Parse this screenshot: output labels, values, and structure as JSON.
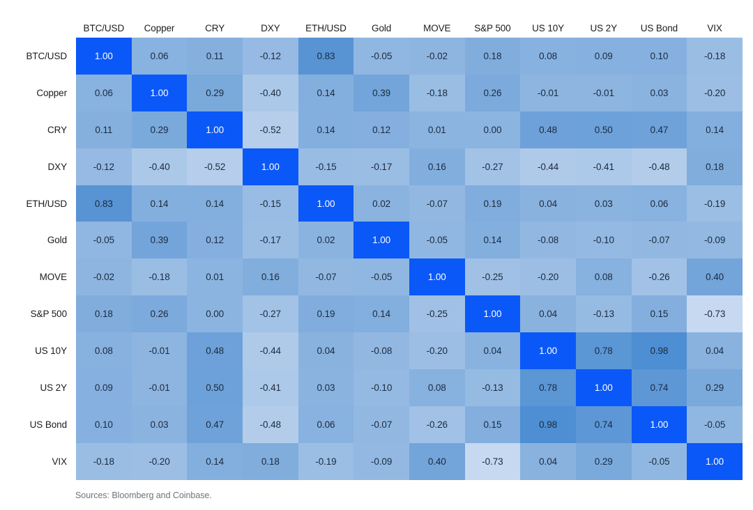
{
  "caption": "Sources: Bloomberg and Coinbase.",
  "colors": {
    "diagonal": "#0b58f8",
    "high_positive": "#4d8dd2",
    "neutral": "#8cb4e0",
    "low_negative": "#c8daf0",
    "text_dark": "#1b2a3e",
    "text_light": "#ffffff",
    "label_text": "#1c1c1e",
    "caption_text": "#6f7378",
    "background": "#ffffff"
  },
  "chart_data": {
    "type": "heatmap",
    "title": "",
    "xlabel": "",
    "ylabel": "",
    "grid": false,
    "legend": "none",
    "zlim": [
      -1,
      1
    ],
    "categories": [
      "BTC/USD",
      "Copper",
      "CRY",
      "DXY",
      "ETH/USD",
      "Gold",
      "MOVE",
      "S&P 500",
      "US 10Y",
      "US 2Y",
      "US Bond",
      "VIX"
    ],
    "x": [
      "BTC/USD",
      "Copper",
      "CRY",
      "DXY",
      "ETH/USD",
      "Gold",
      "MOVE",
      "S&P 500",
      "US 10Y",
      "US 2Y",
      "US Bond",
      "VIX"
    ],
    "y": [
      "BTC/USD",
      "Copper",
      "CRY",
      "DXY",
      "ETH/USD",
      "Gold",
      "MOVE",
      "S&P 500",
      "US 10Y",
      "US 2Y",
      "US Bond",
      "VIX"
    ],
    "values": [
      [
        1.0,
        0.06,
        0.11,
        -0.12,
        0.83,
        -0.05,
        -0.02,
        0.18,
        0.08,
        0.09,
        0.1,
        -0.18
      ],
      [
        0.06,
        1.0,
        0.29,
        -0.4,
        0.14,
        0.39,
        -0.18,
        0.26,
        -0.01,
        -0.01,
        0.03,
        -0.2
      ],
      [
        0.11,
        0.29,
        1.0,
        -0.52,
        0.14,
        0.12,
        0.01,
        0.0,
        0.48,
        0.5,
        0.47,
        0.14
      ],
      [
        -0.12,
        -0.4,
        -0.52,
        1.0,
        -0.15,
        -0.17,
        0.16,
        -0.27,
        -0.44,
        -0.41,
        -0.48,
        0.18
      ],
      [
        0.83,
        0.14,
        0.14,
        -0.15,
        1.0,
        0.02,
        -0.07,
        0.19,
        0.04,
        0.03,
        0.06,
        -0.19
      ],
      [
        -0.05,
        0.39,
        0.12,
        -0.17,
        0.02,
        1.0,
        -0.05,
        0.14,
        -0.08,
        -0.1,
        -0.07,
        -0.09
      ],
      [
        -0.02,
        -0.18,
        0.01,
        0.16,
        -0.07,
        -0.05,
        1.0,
        -0.25,
        -0.2,
        0.08,
        -0.26,
        0.4
      ],
      [
        0.18,
        0.26,
        0.0,
        -0.27,
        0.19,
        0.14,
        -0.25,
        1.0,
        0.04,
        -0.13,
        0.15,
        -0.73
      ],
      [
        0.08,
        -0.01,
        0.48,
        -0.44,
        0.04,
        -0.08,
        -0.2,
        0.04,
        1.0,
        0.78,
        0.98,
        0.04
      ],
      [
        0.09,
        -0.01,
        0.5,
        -0.41,
        0.03,
        -0.1,
        0.08,
        -0.13,
        0.78,
        1.0,
        0.74,
        0.29
      ],
      [
        0.1,
        0.03,
        0.47,
        -0.48,
        0.06,
        -0.07,
        -0.26,
        0.15,
        0.98,
        0.74,
        1.0,
        -0.05
      ],
      [
        -0.18,
        -0.2,
        0.14,
        0.18,
        -0.19,
        -0.09,
        0.4,
        -0.73,
        0.04,
        0.29,
        -0.05,
        1.0
      ]
    ],
    "labels": [
      [
        "1.00",
        "0.06",
        "0.11",
        "-0.12",
        "0.83",
        "-0.05",
        "-0.02",
        "0.18",
        "0.08",
        "0.09",
        "0.10",
        "-0.18"
      ],
      [
        "0.06",
        "1.00",
        "0.29",
        "-0.40",
        "0.14",
        "0.39",
        "-0.18",
        "0.26",
        "-0.01",
        "-0.01",
        "0.03",
        "-0.20"
      ],
      [
        "0.11",
        "0.29",
        "1.00",
        "-0.52",
        "0.14",
        "0.12",
        "0.01",
        "0.00",
        "0.48",
        "0.50",
        "0.47",
        "0.14"
      ],
      [
        "-0.12",
        "-0.40",
        "-0.52",
        "1.00",
        "-0.15",
        "-0.17",
        "0.16",
        "-0.27",
        "-0.44",
        "-0.41",
        "-0.48",
        "0.18"
      ],
      [
        "0.83",
        "0.14",
        "0.14",
        "-0.15",
        "1.00",
        "0.02",
        "-0.07",
        "0.19",
        "0.04",
        "0.03",
        "0.06",
        "-0.19"
      ],
      [
        "-0.05",
        "0.39",
        "0.12",
        "-0.17",
        "0.02",
        "1.00",
        "-0.05",
        "0.14",
        "-0.08",
        "-0.10",
        "-0.07",
        "-0.09"
      ],
      [
        "-0.02",
        "-0.18",
        "0.01",
        "0.16",
        "-0.07",
        "-0.05",
        "1.00",
        "-0.25",
        "-0.20",
        "0.08",
        "-0.26",
        "0.40"
      ],
      [
        "0.18",
        "0.26",
        "0.00",
        "-0.27",
        "0.19",
        "0.14",
        "-0.25",
        "1.00",
        "0.04",
        "-0.13",
        "0.15",
        "-0.73"
      ],
      [
        "0.08",
        "-0.01",
        "0.48",
        "-0.44",
        "0.04",
        "-0.08",
        "-0.20",
        "0.04",
        "1.00",
        "0.78",
        "0.98",
        "0.04"
      ],
      [
        "0.09",
        "-0.01",
        "0.50",
        "-0.41",
        "0.03",
        "-0.10",
        "0.08",
        "-0.13",
        "0.78",
        "1.00",
        "0.74",
        "0.29"
      ],
      [
        "0.10",
        "0.03",
        "0.47",
        "-0.48",
        "0.06",
        "-0.07",
        "-0.26",
        "0.15",
        "0.98",
        "0.74",
        "1.00",
        "-0.05"
      ],
      [
        "-0.18",
        "-0.20",
        "0.14",
        "0.18",
        "-0.19",
        "-0.09",
        "0.40",
        "-0.73",
        "0.04",
        "0.29",
        "-0.05",
        "1.00"
      ]
    ]
  }
}
